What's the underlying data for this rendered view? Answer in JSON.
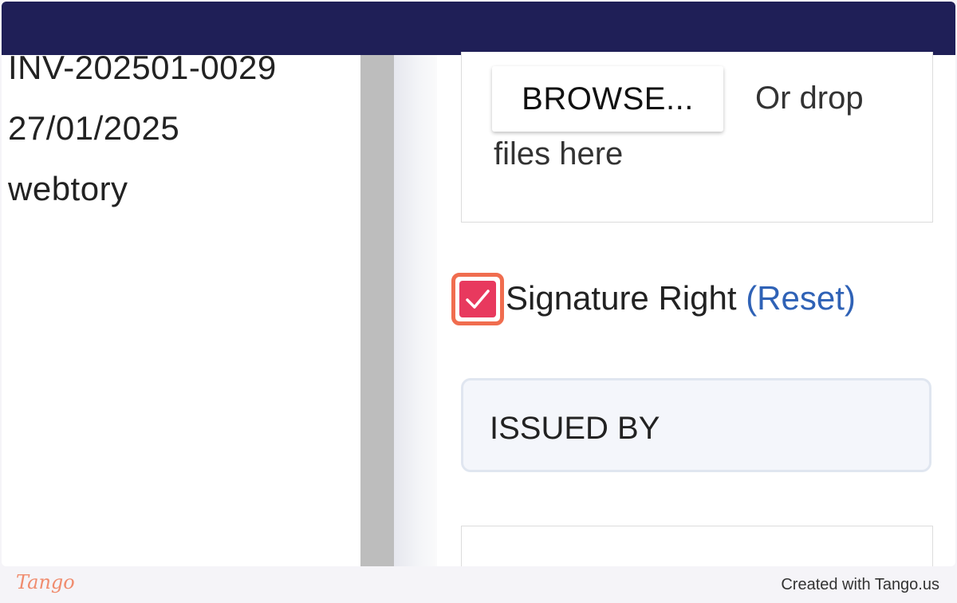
{
  "left_panel": {
    "invoice_number": "INV-202501-0029",
    "invoice_date": "27/01/2025",
    "customer": "webtory"
  },
  "upload": {
    "browse_label": "BROWSE...",
    "drop_hint_line1": "Or drop",
    "drop_hint_line2": "files here"
  },
  "signature": {
    "label": "Signature Right",
    "reset_label": "(Reset)",
    "checked": true
  },
  "issued_by": {
    "label": "ISSUED BY"
  },
  "footer": {
    "logo": "Tango",
    "credit": "Created with Tango.us"
  },
  "colors": {
    "topbar": "#1f1f57",
    "checkbox": "#e8395e",
    "highlight": "#f06d4f",
    "link": "#2f62b6"
  }
}
